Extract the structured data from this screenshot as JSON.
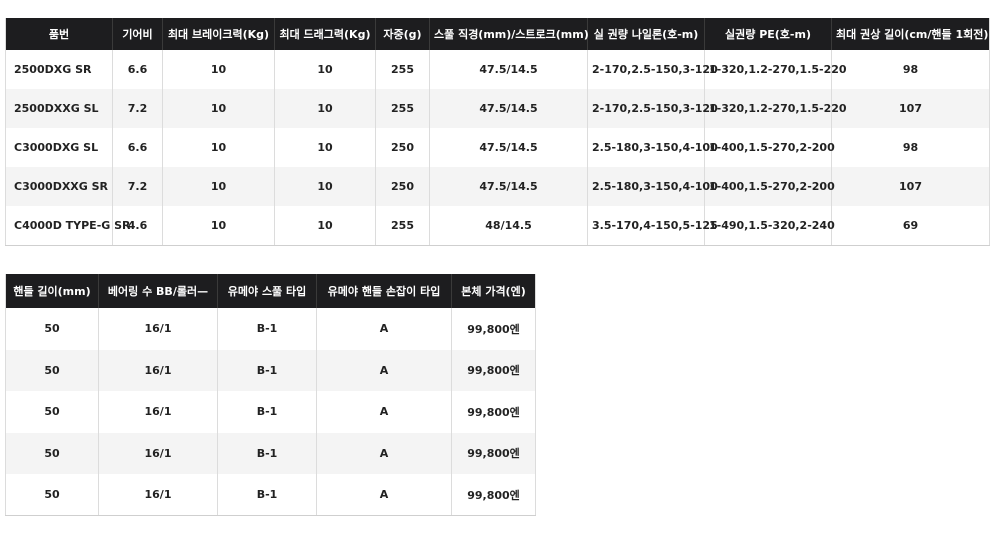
{
  "spec_table": {
    "headers": [
      "품번",
      "기어비",
      "최대 브레이크력(Kg)",
      "최대 드래그력(Kg)",
      "자중(g)",
      "스풀 직경(mm)/스트로크(mm)",
      "실 권량 나일론(호-m)",
      "실권량 PE(호-m)",
      "최대 권상 길이(cm/핸들 1회전)"
    ],
    "rows": [
      [
        "2500DXG SR",
        "6.6",
        "10",
        "10",
        "255",
        "47.5/14.5",
        "2-170,2.5-150,3-120",
        "1-320,1.2-270,1.5-220",
        "98"
      ],
      [
        "2500DXXG SL",
        "7.2",
        "10",
        "10",
        "255",
        "47.5/14.5",
        "2-170,2.5-150,3-120",
        "1-320,1.2-270,1.5-220",
        "107"
      ],
      [
        "C3000DXG SL",
        "6.6",
        "10",
        "10",
        "250",
        "47.5/14.5",
        "2.5-180,3-150,4-100",
        "1-400,1.5-270,2-200",
        "98"
      ],
      [
        "C3000DXXG SR",
        "7.2",
        "10",
        "10",
        "250",
        "47.5/14.5",
        "2.5-180,3-150,4-100",
        "1-400,1.5-270,2-200",
        "107"
      ],
      [
        "C4000D TYPE-G SR",
        "4.6",
        "10",
        "10",
        "255",
        "48/14.5",
        "3.5-170,4-150,5-125",
        "1-490,1.5-320,2-240",
        "69"
      ]
    ]
  },
  "price_table": {
    "headers": [
      "핸들 길이(mm)",
      "베어링 수 BB/롤러—",
      "유메야 스풀 타입",
      "유메야 핸들 손잡이 타입",
      "본체 가격(엔)"
    ],
    "rows": [
      [
        "50",
        "16/1",
        "B-1",
        "A",
        "99,800엔"
      ],
      [
        "50",
        "16/1",
        "B-1",
        "A",
        "99,800엔"
      ],
      [
        "50",
        "16/1",
        "B-1",
        "A",
        "99,800엔"
      ],
      [
        "50",
        "16/1",
        "B-1",
        "A",
        "99,800엔"
      ],
      [
        "50",
        "16/1",
        "B-1",
        "A",
        "99,800엔"
      ]
    ]
  }
}
